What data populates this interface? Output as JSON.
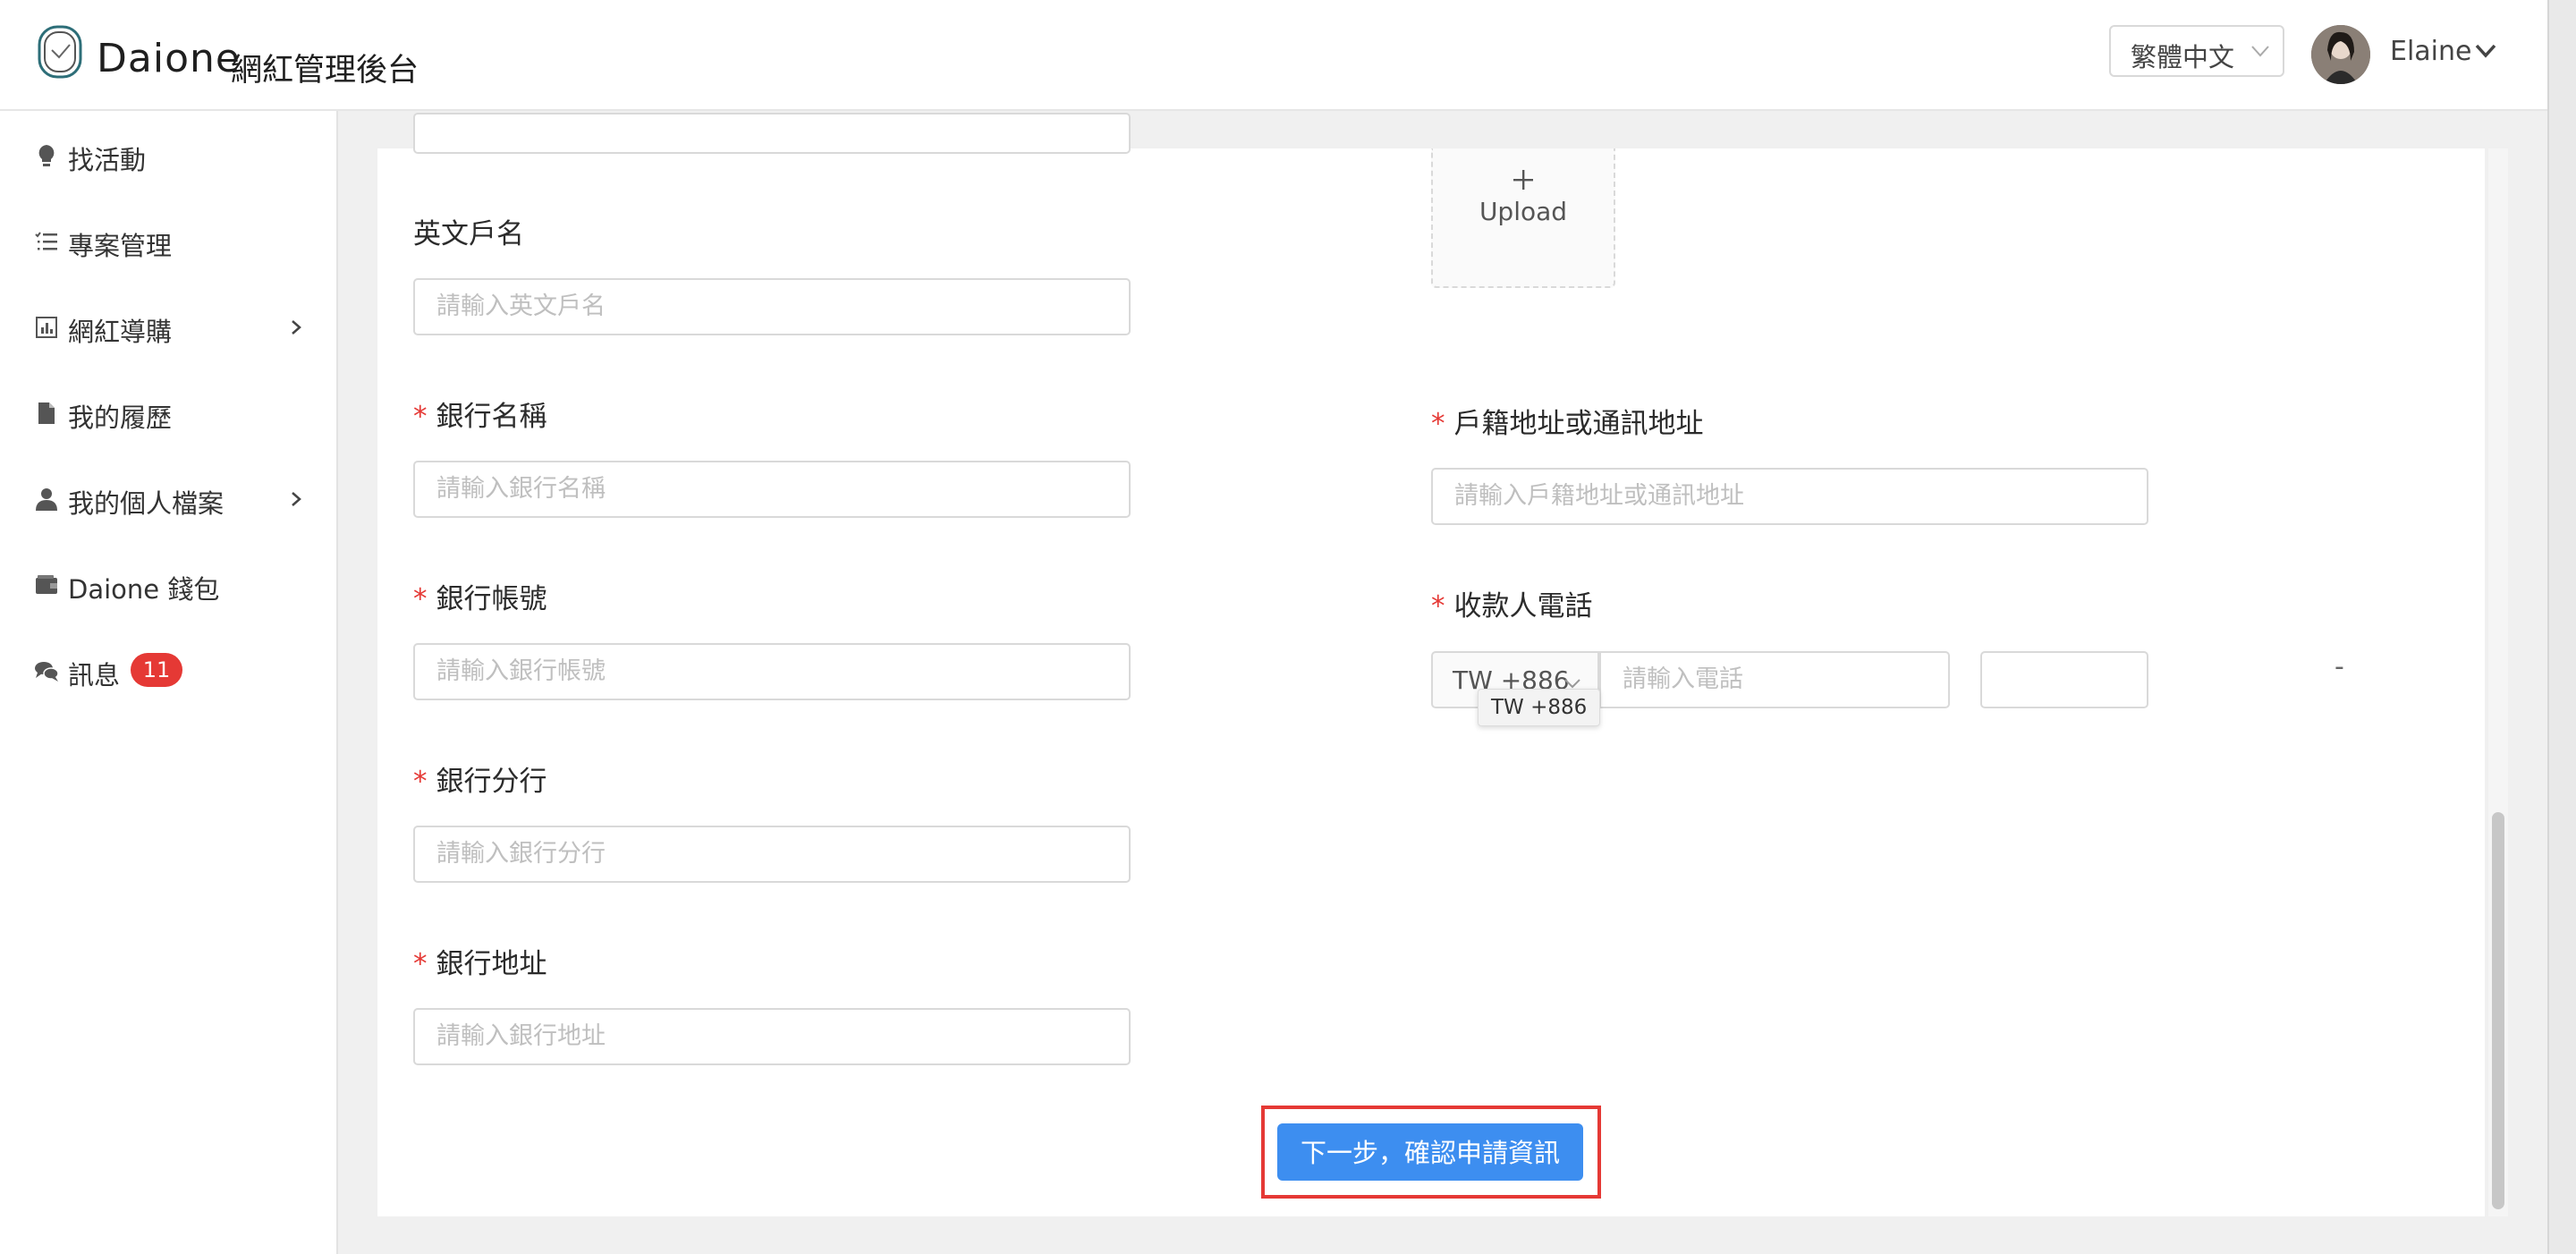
{
  "header": {
    "app_name": "Daione",
    "app_subtitle": "網紅管理後台",
    "language": "繁體中文",
    "user_name": "Elaine"
  },
  "sidebar": {
    "items": [
      {
        "label": "找活動",
        "icon": "lightbulb-icon"
      },
      {
        "label": "專案管理",
        "icon": "list-icon"
      },
      {
        "label": "網紅導購",
        "icon": "chart-icon",
        "has_submenu": true
      },
      {
        "label": "我的履歷",
        "icon": "file-icon"
      },
      {
        "label": "我的個人檔案",
        "icon": "user-icon",
        "has_submenu": true
      },
      {
        "label": "Daione 錢包",
        "icon": "wallet-icon"
      },
      {
        "label": "訊息",
        "icon": "chat-icon",
        "badge": "11"
      }
    ]
  },
  "form": {
    "english_name": {
      "label": "英文戶名",
      "placeholder": "請輸入英文戶名",
      "required": false
    },
    "bank_name": {
      "label": "銀行名稱",
      "placeholder": "請輸入銀行名稱",
      "required": true
    },
    "bank_account": {
      "label": "銀行帳號",
      "placeholder": "請輸入銀行帳號",
      "required": true
    },
    "bank_branch": {
      "label": "銀行分行",
      "placeholder": "請輸入銀行分行",
      "required": true
    },
    "bank_address": {
      "label": "銀行地址",
      "placeholder": "請輸入銀行地址",
      "required": true
    },
    "upload": {
      "label": "Upload"
    },
    "household_address": {
      "label": "戶籍地址或通訊地址",
      "placeholder": "請輸入戶籍地址或通訊地址",
      "required": true
    },
    "payee_phone": {
      "label": "收款人電話",
      "country_code": "TW +886",
      "tooltip": "TW +886",
      "phone_placeholder": "請輸入電話",
      "separator": "-",
      "required": true
    },
    "required_mark": "*",
    "next_button": "下一步，確認申請資訊"
  },
  "colors": {
    "primary": "#3d8ef0",
    "required": "#e53935",
    "highlight": "#e53935",
    "badge": "#e53935"
  }
}
